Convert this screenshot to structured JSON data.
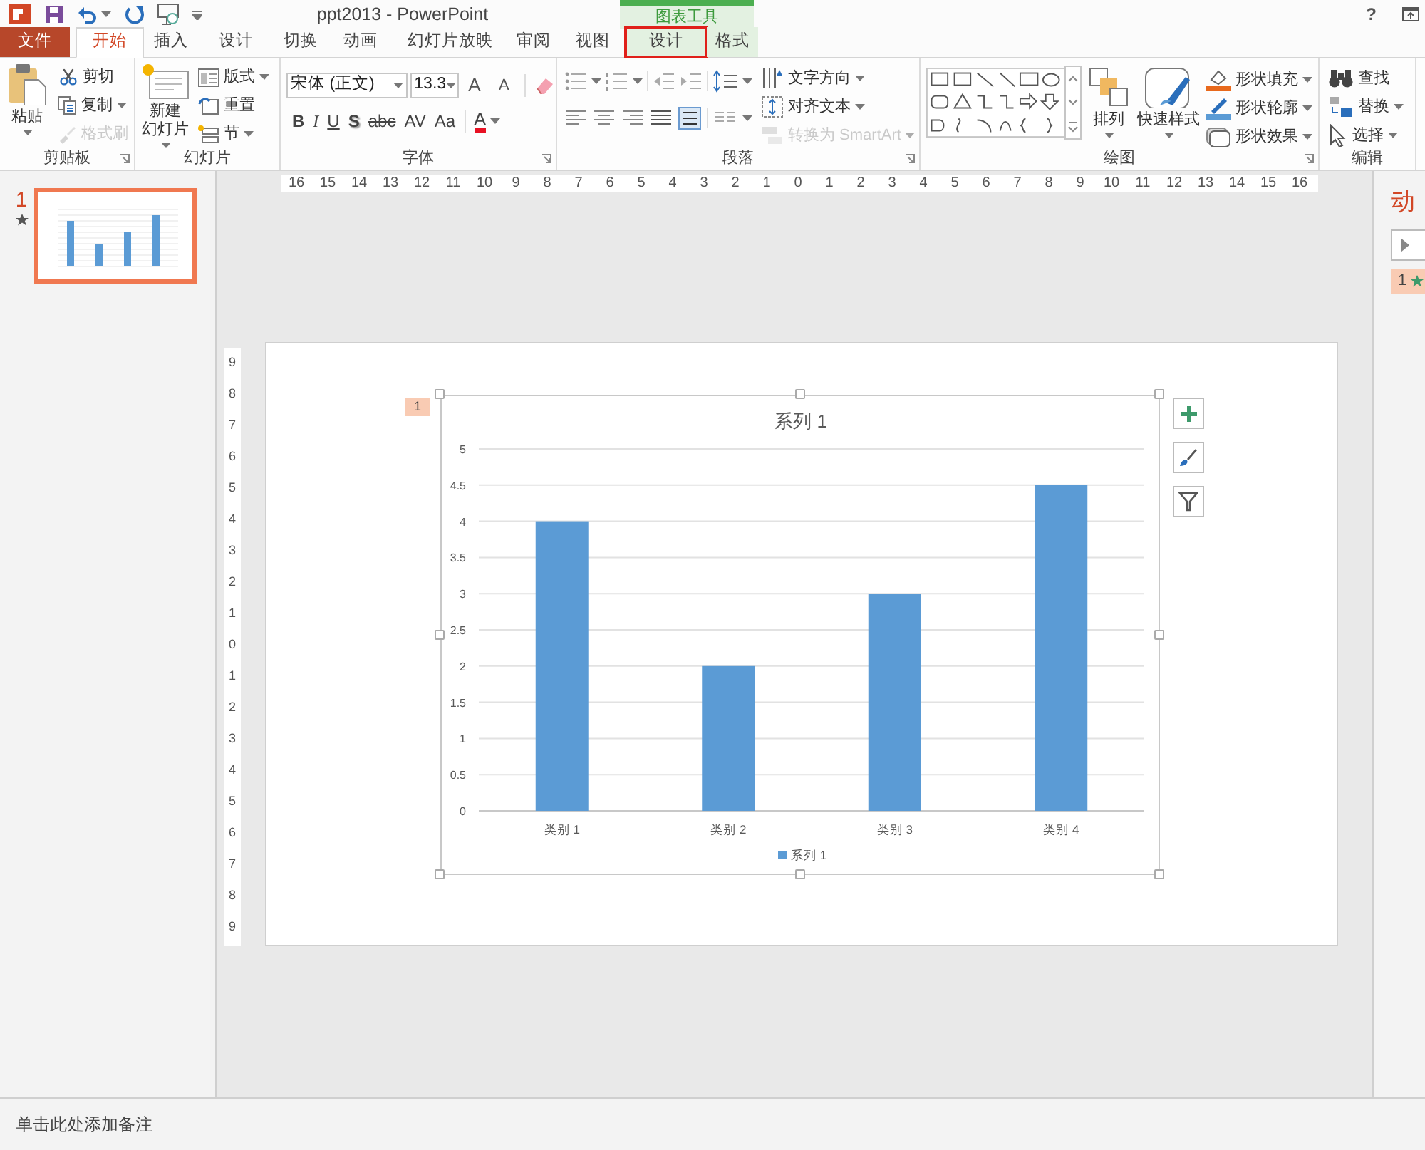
{
  "window": {
    "title": "ppt2013 - PowerPoint",
    "help": "?"
  },
  "contextual_group": {
    "label": "图表工具"
  },
  "tabs": [
    {
      "label": "文件",
      "kind": "file",
      "selected": false,
      "highlighted": false
    },
    {
      "label": "开始",
      "kind": "normal",
      "selected": true,
      "highlighted": false
    },
    {
      "label": "插入",
      "kind": "normal",
      "selected": false,
      "highlighted": false
    },
    {
      "label": "设计",
      "kind": "normal",
      "selected": false,
      "highlighted": false
    },
    {
      "label": "切换",
      "kind": "normal",
      "selected": false,
      "highlighted": false
    },
    {
      "label": "动画",
      "kind": "normal",
      "selected": false,
      "highlighted": false
    },
    {
      "label": "幻灯片放映",
      "kind": "normal",
      "selected": false,
      "highlighted": false
    },
    {
      "label": "审阅",
      "kind": "normal",
      "selected": false,
      "highlighted": false
    },
    {
      "label": "视图",
      "kind": "normal",
      "selected": false,
      "highlighted": false
    },
    {
      "label": "设计",
      "kind": "contextual",
      "selected": false,
      "highlighted": true
    },
    {
      "label": "格式",
      "kind": "contextual",
      "selected": false,
      "highlighted": false
    }
  ],
  "ribbon": {
    "groups": [
      {
        "kind": "clipboard",
        "label": "剪贴板",
        "large": {
          "lines": [
            "粘贴"
          ],
          "dropdown": true
        },
        "items": [
          {
            "label": "剪切",
            "dropdown": false,
            "disabled": false
          },
          {
            "label": "复制",
            "dropdown": true,
            "disabled": false
          },
          {
            "label": "格式刷",
            "dropdown": false,
            "disabled": true
          }
        ]
      },
      {
        "kind": "slides",
        "label": "幻灯片",
        "large": {
          "lines": [
            "新建",
            "幻灯片"
          ],
          "dropdown": true
        },
        "items": [
          {
            "label": "版式",
            "dropdown": true,
            "disabled": false
          },
          {
            "label": "重置",
            "dropdown": false,
            "disabled": false
          },
          {
            "label": "节",
            "dropdown": true,
            "disabled": false
          }
        ]
      },
      {
        "kind": "font",
        "label": "字体",
        "font_name": "宋体 (正文)",
        "font_size": "13.3",
        "size_buttons": [
          "A",
          "A"
        ],
        "format_buttons": [
          "B",
          "I",
          "U",
          "S",
          "abc",
          "AV",
          "Aa"
        ],
        "color_button": "A"
      },
      {
        "kind": "paragraph",
        "label": "段落",
        "items": [
          {
            "label": "文字方向",
            "dropdown": true,
            "disabled": false
          },
          {
            "label": "对齐文本",
            "dropdown": true,
            "disabled": false
          },
          {
            "label": "转换为 SmartArt",
            "dropdown": true,
            "disabled": true
          }
        ]
      },
      {
        "kind": "drawing",
        "label": "绘图",
        "large_buttons": [
          {
            "label": "排列"
          },
          {
            "label": "快速样式"
          }
        ],
        "items": [
          {
            "label": "形状填充",
            "dropdown": true,
            "disabled": false
          },
          {
            "label": "形状轮廓",
            "dropdown": true,
            "disabled": false
          },
          {
            "label": "形状效果",
            "dropdown": true,
            "disabled": false
          }
        ]
      },
      {
        "kind": "editing",
        "label": "编辑",
        "items": [
          {
            "label": "查找",
            "dropdown": false,
            "disabled": false
          },
          {
            "label": "替换",
            "dropdown": true,
            "disabled": false
          },
          {
            "label": "选择",
            "dropdown": true,
            "disabled": false
          }
        ]
      }
    ]
  },
  "slide_panel": {
    "slides": [
      {
        "number": "1",
        "selected": true
      }
    ]
  },
  "rulers": {
    "horizontal": [
      "16",
      "15",
      "14",
      "13",
      "12",
      "11",
      "10",
      "9",
      "8",
      "7",
      "6",
      "5",
      "4",
      "3",
      "2",
      "1",
      "0",
      "1",
      "2",
      "3",
      "4",
      "5",
      "6",
      "7",
      "8",
      "9",
      "10",
      "11",
      "12",
      "13",
      "14",
      "15",
      "16"
    ],
    "vertical": [
      "9",
      "8",
      "7",
      "6",
      "5",
      "4",
      "3",
      "2",
      "1",
      "0",
      "1",
      "2",
      "3",
      "4",
      "5",
      "6",
      "7",
      "8",
      "9"
    ]
  },
  "slide": {
    "animation_tag": "1",
    "chart": {
      "title": "系列 1",
      "chart_data": {
        "type": "bar",
        "categories": [
          "类别 1",
          "类别 2",
          "类别 3",
          "类别 4"
        ],
        "series": [
          {
            "name": "系列 1",
            "color": "#5b9bd5",
            "values": [
              4,
              2,
              3,
              4.5
            ]
          }
        ],
        "grid": true,
        "ylim": [
          0,
          5
        ],
        "yticks": [
          0,
          0.5,
          1,
          1.5,
          2,
          2.5,
          3,
          3.5,
          4,
          4.5,
          5
        ]
      }
    }
  },
  "animation_pane": {
    "title": "动",
    "items": [
      {
        "number": "1"
      }
    ]
  },
  "notes": {
    "placeholder": "单击此处添加备注"
  }
}
